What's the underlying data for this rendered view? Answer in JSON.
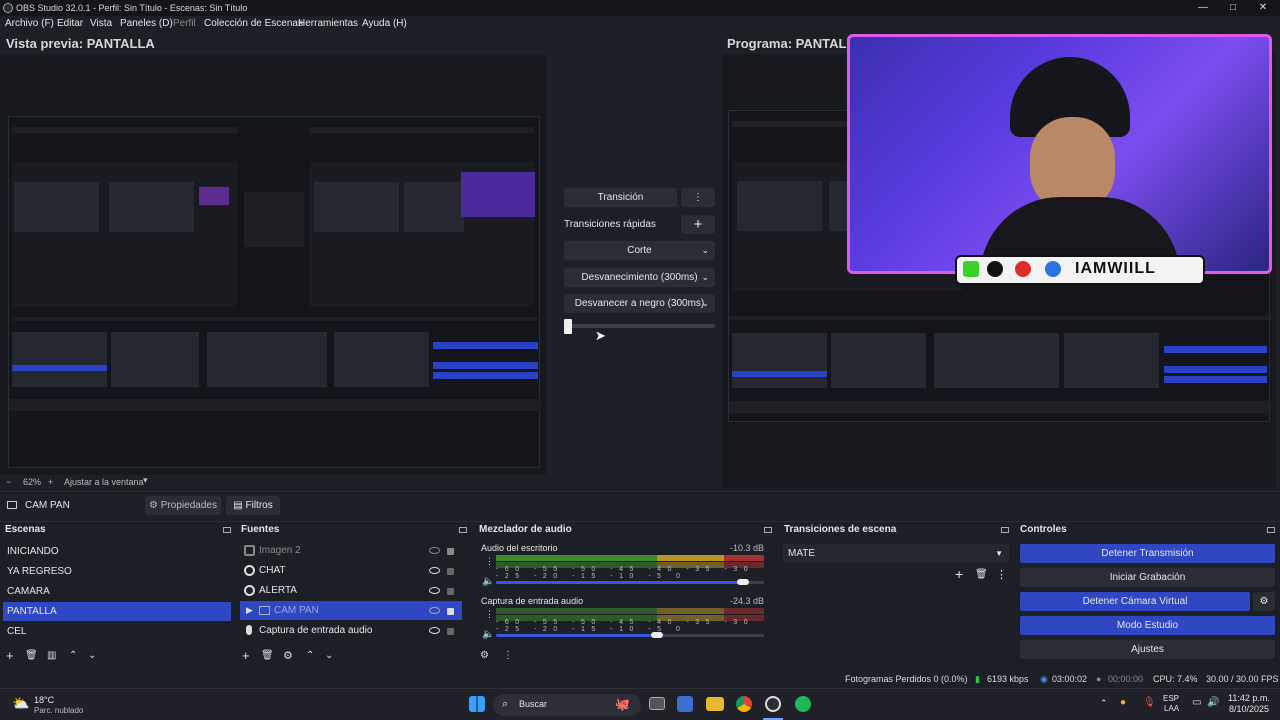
{
  "window": {
    "title": "OBS Studio 32.0.1 - Perfil: Sin Título - Escenas: Sin Título",
    "min": "—",
    "max": "□",
    "close": "✕"
  },
  "menu": [
    "Archivo (F)",
    "Editar",
    "Vista",
    "Paneles (D)",
    "Perfil",
    "Colección de Escenas",
    "Herramientas",
    "Ayuda (H)"
  ],
  "preview": {
    "label": "Vista previa: PANTALLA",
    "zoom": "62%",
    "fit": "Ajustar a la ventana",
    "zoom_minus": "−",
    "zoom_plus": "+"
  },
  "program": {
    "label": "Programa: PANTALLA"
  },
  "overlay": {
    "handle": "IAMWIILL"
  },
  "transition_panel": {
    "transition_button": "Transición",
    "quick_label": "Transiciones rápidas",
    "options": [
      "Corte",
      "Desvanecimiento (300ms)",
      "Desvanecer a negro (300ms)"
    ]
  },
  "source_bar": {
    "source_name": "CAM PAN",
    "properties": "Propiedades",
    "filters": "Filtros"
  },
  "scenes": {
    "title": "Escenas",
    "items": [
      "INICIANDO",
      "YA REGRESO",
      "CAMARA",
      "PANTALLA",
      "CEL"
    ],
    "selected": 3
  },
  "sources": {
    "title": "Fuentes",
    "items": [
      {
        "name": "Imagen 2",
        "hidden": true
      },
      {
        "name": "CHAT",
        "hidden": false
      },
      {
        "name": "ALERTA",
        "hidden": false
      },
      {
        "name": "CAM PAN",
        "hidden": true,
        "selected": true
      },
      {
        "name": "Captura de entrada audio",
        "hidden": false
      }
    ]
  },
  "mixer": {
    "title": "Mezclador de audio",
    "channels": [
      {
        "name": "Audio del escritorio",
        "db": "-10.3 dB",
        "volume": 0.92
      },
      {
        "name": "Captura de entrada audio",
        "db": "-24.3 dB",
        "volume": 0.6
      }
    ],
    "scale": [
      "-60",
      "-55",
      "-50",
      "-45",
      "-40",
      "-35",
      "-30",
      "-25",
      "-20",
      "-15",
      "-10",
      "-5",
      "0"
    ]
  },
  "transitions": {
    "title": "Transiciones de escena",
    "selected": "MATE"
  },
  "controls": {
    "title": "Controles",
    "buttons": [
      "Detener Transmisión",
      "Iniciar Grabación",
      "Detener Cámara Virtual",
      "Modo Estudio",
      "Ajustes"
    ]
  },
  "status": {
    "dropped": "Fotogramas Perdidos 0 (0.0%)",
    "bitrate": "6193 kbps",
    "stream_time": "03:00:02",
    "rec_time": "00:00:00",
    "cpu": "CPU: 7.4%",
    "fps": "30.00 / 30.00 FPS"
  },
  "taskbar": {
    "temp": "18°C",
    "weather": "Parc. nublado",
    "search": "Buscar",
    "lang1": "ESP",
    "lang2": "LAA",
    "time": "11:42 p.m.",
    "date": "8/10/2025"
  },
  "colors": {
    "accent": "#2f47c3",
    "bg": "#1d1f26",
    "panel": "#2b2d35"
  }
}
